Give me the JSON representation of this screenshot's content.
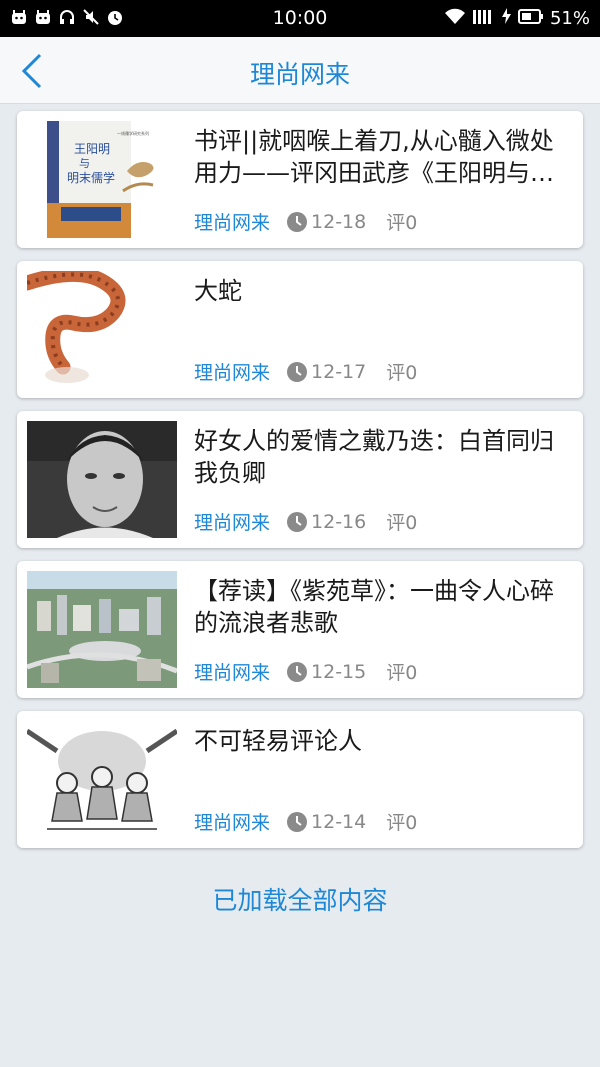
{
  "status_bar": {
    "time": "10:00",
    "battery": "51%",
    "icons": [
      "android-icon",
      "android-icon",
      "headphones-icon",
      "mute-icon",
      "alarm-icon",
      "wifi-icon",
      "signal-icon",
      "charging-icon",
      "battery-icon"
    ]
  },
  "header": {
    "title": "理尚网来",
    "back_icon": "chevron-left-icon"
  },
  "articles": [
    {
      "title": "书评||就咽喉上着刀,从心髓入微处用力——评冈田武彦《王阳明与明末儒学》",
      "source": "理尚网来",
      "date": "12-18",
      "comments": "评0",
      "thumb": "book-cover",
      "thumb_text": {
        "book_title": "王阳明与明末儒学",
        "series": "一线儒学研究系列"
      }
    },
    {
      "title": "大蛇",
      "source": "理尚网来",
      "date": "12-17",
      "comments": "评0",
      "thumb": "snake"
    },
    {
      "title": "好女人的爱情之戴乃迭：白首同归我负卿",
      "source": "理尚网来",
      "date": "12-16",
      "comments": "评0",
      "thumb": "portrait"
    },
    {
      "title": "【荐读】《紫苑草》：一曲令人心碎的流浪者悲歌",
      "source": "理尚网来",
      "date": "12-15",
      "comments": "评0",
      "thumb": "city-aerial"
    },
    {
      "title": "不可轻易评论人",
      "source": "理尚网来",
      "date": "12-14",
      "comments": "评0",
      "thumb": "cartoon"
    }
  ],
  "footer": {
    "loaded_text": "已加载全部内容"
  },
  "colors": {
    "accent": "#1e88d6",
    "background": "#e6ebf0"
  }
}
